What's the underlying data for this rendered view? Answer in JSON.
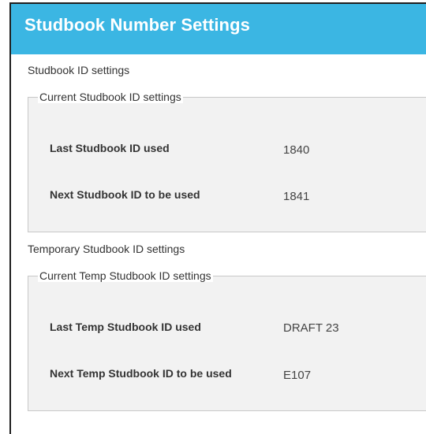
{
  "window": {
    "title": "Studbook Number Settings"
  },
  "studbook_section": {
    "label": "Studbook ID settings",
    "group_legend": "Current Studbook ID settings",
    "rows": [
      {
        "label": "Last Studbook ID used",
        "value": "1840"
      },
      {
        "label": "Next Studbook ID to be used",
        "value": "1841"
      }
    ]
  },
  "temp_section": {
    "label": "Temporary Studbook ID settings",
    "group_legend": "Current Temp Studbook ID settings",
    "rows": [
      {
        "label": "Last Temp Studbook ID used",
        "value": "DRAFT 23"
      },
      {
        "label": "Next Temp Studbook ID to be used",
        "value": "E107"
      }
    ]
  },
  "colors": {
    "titlebar": "#3bb6e3",
    "group_background": "#f2f2f2",
    "group_border": "#c8c8c8"
  }
}
